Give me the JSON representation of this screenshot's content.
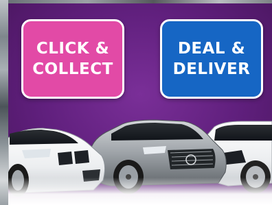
{
  "buttons": {
    "click_collect": {
      "line1": "CLICK &",
      "line2": "COLLECT",
      "color": "#e24aa6"
    },
    "deal_deliver": {
      "line1": "DEAL &",
      "line2": "DELIVER",
      "color": "#1666c4"
    }
  },
  "colors": {
    "background": "#5f1f7c",
    "border": "#ffffff"
  },
  "cars": [
    {
      "name": "white-hatchback-car"
    },
    {
      "name": "silver-hatchback-car"
    },
    {
      "name": "white-suv-car"
    }
  ]
}
